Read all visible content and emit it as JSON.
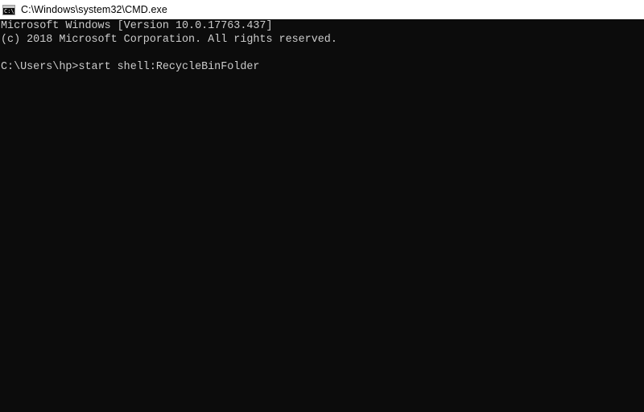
{
  "window": {
    "title": "C:\\Windows\\system32\\CMD.exe",
    "icon": "command-prompt-icon",
    "icon_text": "C:\\"
  },
  "console": {
    "lines": [
      "Microsoft Windows [Version 10.0.17763.437]",
      "(c) 2018 Microsoft Corporation. All rights reserved."
    ],
    "prompt": "C:\\Users\\hp>",
    "command": "start shell:RecycleBinFolder"
  },
  "colors": {
    "background": "#0c0c0c",
    "text": "#cccccc",
    "titlebar": "#ffffff"
  }
}
